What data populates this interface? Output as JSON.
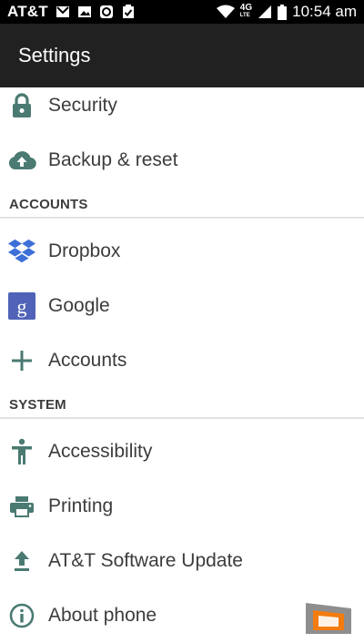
{
  "status_bar": {
    "carrier": "AT&T",
    "network_badge": "4G",
    "network_sub": "LTE",
    "time": "10:54 am"
  },
  "app_bar": {
    "title": "Settings"
  },
  "items": {
    "security": {
      "label": "Security",
      "icon": "lock-icon"
    },
    "backup": {
      "label": "Backup & reset",
      "icon": "cloud-upload-icon"
    },
    "dropbox": {
      "label": "Dropbox",
      "icon": "dropbox-icon"
    },
    "google": {
      "label": "Google",
      "icon": "google-icon"
    },
    "accounts": {
      "label": "Accounts",
      "icon": "plus-icon"
    },
    "accessibility": {
      "label": "Accessibility",
      "icon": "accessibility-icon"
    },
    "printing": {
      "label": "Printing",
      "icon": "printer-icon"
    },
    "software_update": {
      "label": "AT&T Software Update",
      "icon": "upload-icon"
    },
    "about": {
      "label": "About phone",
      "icon": "info-icon"
    }
  },
  "sections": {
    "accounts": "ACCOUNTS",
    "system": "SYSTEM"
  },
  "colors": {
    "icon": "#4a7a72",
    "status_bar": "#000000",
    "app_bar": "#212121",
    "dropbox": "#3d6fd8",
    "google": "#5063b8"
  }
}
